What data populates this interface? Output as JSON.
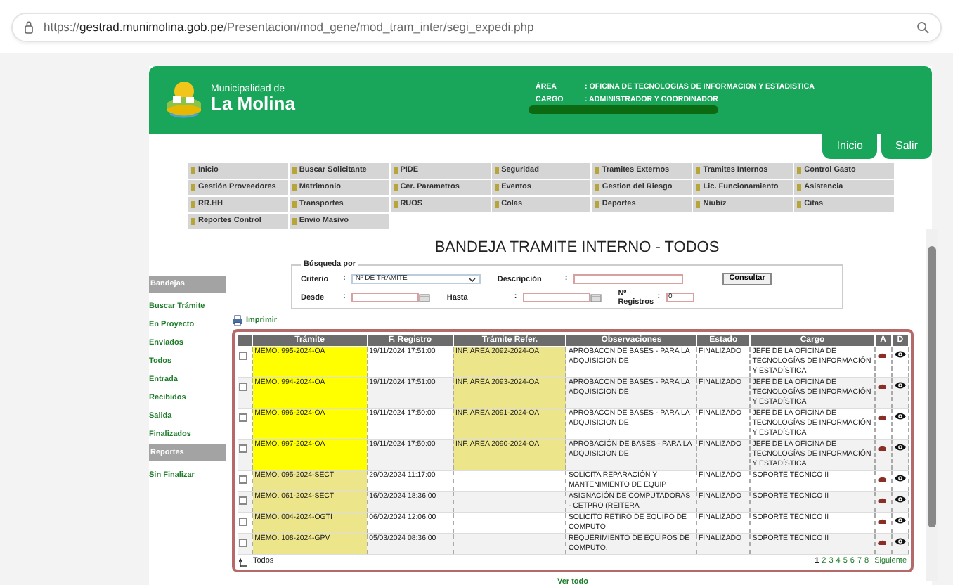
{
  "browser": {
    "url": "https://**gestrad.munimolina.gob.pe**/Presentacion/mod_gene/mod_tram_inter/segi_expedi.php"
  },
  "header": {
    "org_line": "Municipalidad de",
    "org_name": "La Molina",
    "info": [
      {
        "label": "ÁREA",
        "value": ": OFICINA DE TECNOLOGIAS DE INFORMACION Y ESTADISTICA"
      },
      {
        "label": "CARGO",
        "value": ": ADMINISTRADOR Y COORDINADOR"
      }
    ]
  },
  "top_tabs": [
    "Inicio",
    "Salir"
  ],
  "menu": [
    "Inicio",
    "Buscar Solicitante",
    "PIDE",
    "Seguridad",
    "Tramites Externos",
    "Tramites Internos",
    "Control Gasto",
    "Gestión Proveedores",
    "Matrimonio",
    "Cer. Parametros",
    "Eventos",
    "Gestion del Riesgo",
    "Lic. Funcionamiento",
    "Asistencia",
    "RR.HH",
    "Transportes",
    "RUOS",
    "Colas",
    "Deportes",
    "Niubiz",
    "Citas",
    "Reportes Control",
    "Envio Masivo"
  ],
  "title": "BANDEJA TRAMITE INTERNO - TODOS",
  "sidebar": [
    {
      "kind": "header",
      "label": "Bandejas"
    },
    {
      "kind": "link",
      "label": "Buscar Trámite"
    },
    {
      "kind": "link",
      "label": "En Proyecto"
    },
    {
      "kind": "link",
      "label": "Enviados"
    },
    {
      "kind": "link",
      "label": "Todos"
    },
    {
      "kind": "link",
      "label": "Entrada"
    },
    {
      "kind": "link",
      "label": "Recibidos"
    },
    {
      "kind": "link",
      "label": "Salida"
    },
    {
      "kind": "link",
      "label": "Finalizados"
    },
    {
      "kind": "header",
      "label": "Reportes"
    },
    {
      "kind": "link",
      "label": "Sin Finalizar"
    }
  ],
  "search": {
    "legend": "Búsqueda por",
    "button": "Consultar",
    "rows": [
      [
        {
          "kind": "select",
          "label": "Criterio",
          "separator": ":",
          "value": "Nº DE TRAMITE"
        },
        {
          "kind": "text",
          "label": "Descripción",
          "separator": ":"
        }
      ],
      [
        {
          "kind": "date",
          "label": "Desde",
          "separator": ":"
        },
        {
          "kind": "date",
          "label": "Hasta",
          "separator": ":"
        },
        {
          "kind": "text",
          "label": "Nº Registros",
          "separator": ":",
          "value": "0"
        }
      ]
    ]
  },
  "print_link": "Imprimir",
  "table": {
    "columns": [
      "Trámite",
      "F. Registro",
      "Trámite Refer.",
      "Observaciones",
      "Estado",
      "Cargo",
      "A",
      "D"
    ],
    "rows": [
      {
        "checked": false,
        "tramite": {
          "text": "MEMO. 995-2024-OA",
          "color": "#ffff00"
        },
        "registro": "19/11/2024 17:51:00",
        "referencia": {
          "text": "INF. AREA 2092-2024-OA",
          "color": "#ede58a"
        },
        "observaciones": "APROBACÓN DE BASES - PARA LA ADQUISICION DE",
        "estado": "FINALIZADO",
        "cargo": "JEFE DE LA OFICINA DE TECNOLOGÍAS DE INFORMACIÓN Y ESTADÍSTICA"
      },
      {
        "checked": false,
        "tramite": {
          "text": "MEMO. 994-2024-OA",
          "color": "#ffff00"
        },
        "registro": "19/11/2024 17:51:00",
        "referencia": {
          "text": "INF. AREA 2093-2024-OA",
          "color": "#ede58a"
        },
        "observaciones": "APROBACÓN DE BASES - PARA LA ADQUISICION DE",
        "estado": "FINALIZADO",
        "cargo": "JEFE DE LA OFICINA DE TECNOLOGÍAS DE INFORMACIÓN Y ESTADÍSTICA"
      },
      {
        "checked": false,
        "tramite": {
          "text": "MEMO. 996-2024-OA",
          "color": "#ffff00"
        },
        "registro": "19/11/2024 17:50:00",
        "referencia": {
          "text": "INF. AREA 2091-2024-OA",
          "color": "#ede58a"
        },
        "observaciones": "APROBACÓN DE BASES - PARA LA ADQUISICION DE",
        "estado": "FINALIZADO",
        "cargo": "JEFE DE LA OFICINA DE TECNOLOGÍAS DE INFORMACIÓN Y ESTADÍSTICA"
      },
      {
        "checked": false,
        "tramite": {
          "text": "MEMO. 997-2024-OA",
          "color": "#ffff00"
        },
        "registro": "19/11/2024 17:50:00",
        "referencia": {
          "text": "INF. AREA 2090-2024-OA",
          "color": "#ede58a"
        },
        "observaciones": "APROBACIÓN DE BASES - PARA LA ADQUISICION DE",
        "estado": "FINALIZADO",
        "cargo": "JEFE DE LA OFICINA DE TECNOLOGÍAS DE INFORMACIÓN Y ESTADÍSTICA"
      },
      {
        "checked": false,
        "tramite": {
          "text": "MEMO. 095-2024-SECT",
          "color": "#ede58a"
        },
        "registro": "29/02/2024 11:17:00",
        "observaciones": "SOLICITA REPARACIÓN Y MANTENIMIENTO DE EQUIP",
        "estado": "FINALIZADO",
        "cargo": "SOPORTE TECNICO II"
      },
      {
        "checked": false,
        "tramite": {
          "text": "MEMO. 061-2024-SECT",
          "color": "#ede58a"
        },
        "registro": "16/02/2024 18:36:00",
        "observaciones": "ASIGNACIÓN DE COMPUTADORAS - CETPRO (REITERA",
        "estado": "FINALIZADO",
        "cargo": "SOPORTE TECNICO II"
      },
      {
        "checked": false,
        "tramite": {
          "text": "MEMO. 004-2024-OGTI",
          "color": "#ede58a"
        },
        "registro": "06/02/2024 12:06:00",
        "observaciones": "SOLICITO RETIRO DE EQUIPO DE COMPUTO",
        "estado": "FINALIZADO",
        "cargo": "SOPORTE TECNICO II"
      },
      {
        "checked": false,
        "tramite": {
          "text": "MEMO. 108-2024-GPV",
          "color": "#ede58a"
        },
        "registro": "05/03/2024 08:36:00",
        "observaciones": "REQUERIMIENTO DE EQUIPOS DE CÓMPUTO.",
        "estado": "FINALIZADO",
        "cargo": "SOPORTE TECNICO II"
      }
    ],
    "select_all": "Todos",
    "pages": [
      {
        "label": "1",
        "selected": true
      },
      {
        "label": "2",
        "selected": false
      },
      {
        "label": "3",
        "selected": false
      },
      {
        "label": "4",
        "selected": false
      },
      {
        "label": "5",
        "selected": false
      },
      {
        "label": "6",
        "selected": false
      },
      {
        "label": "7",
        "selected": false
      },
      {
        "label": "8",
        "selected": false
      }
    ],
    "next": "Siguiente"
  },
  "view_all": "Ver todo"
}
